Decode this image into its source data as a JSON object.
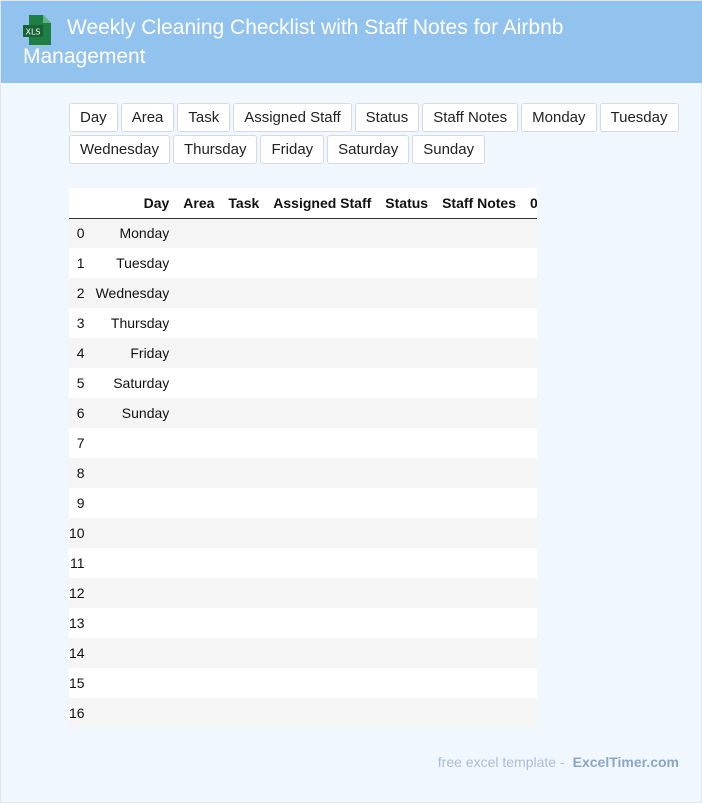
{
  "header": {
    "title": "Weekly Cleaning Checklist with Staff Notes for Airbnb Management",
    "icon": "xls-file-icon",
    "icon_label": "XLS",
    "icon_color": "#1e7e45"
  },
  "chips": [
    "Day",
    "Area",
    "Task",
    "Assigned Staff",
    "Status",
    "Staff Notes",
    "Monday",
    "Tuesday",
    "Wednesday",
    "Thursday",
    "Friday",
    "Saturday",
    "Sunday"
  ],
  "table": {
    "columns": [
      "",
      "Day",
      "Area",
      "Task",
      "Assigned Staff",
      "Status",
      "Staff Notes",
      "0"
    ],
    "rows": [
      [
        "0",
        "Monday"
      ],
      [
        "1",
        "Tuesday"
      ],
      [
        "2",
        "Wednesday"
      ],
      [
        "3",
        "Thursday"
      ],
      [
        "4",
        "Friday"
      ],
      [
        "5",
        "Saturday"
      ],
      [
        "6",
        "Sunday"
      ],
      [
        "7",
        ""
      ],
      [
        "8",
        ""
      ],
      [
        "9",
        ""
      ],
      [
        "10",
        ""
      ],
      [
        "11",
        ""
      ],
      [
        "12",
        ""
      ],
      [
        "13",
        ""
      ],
      [
        "14",
        ""
      ],
      [
        "15",
        ""
      ],
      [
        "16",
        ""
      ]
    ]
  },
  "footer": {
    "prefix": "free excel template -",
    "brand": "ExcelTimer.com"
  }
}
